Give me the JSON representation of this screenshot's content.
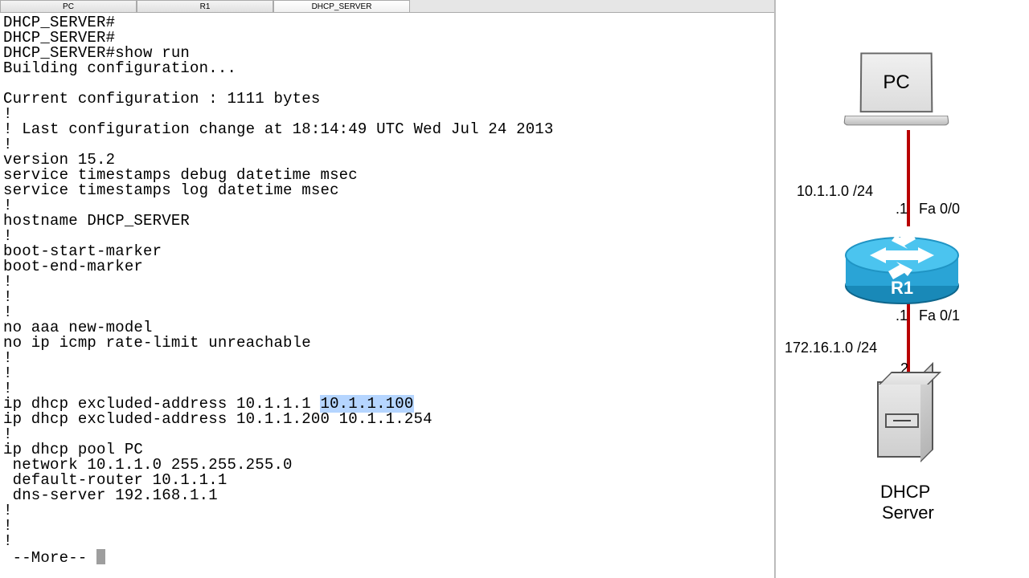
{
  "tabs": [
    {
      "label": "PC"
    },
    {
      "label": "R1"
    },
    {
      "label": "DHCP_SERVER"
    }
  ],
  "activeTab": 2,
  "terminal": {
    "lines": [
      "DHCP_SERVER#",
      "DHCP_SERVER#",
      "DHCP_SERVER#show run",
      "Building configuration...",
      "",
      "Current configuration : 1111 bytes",
      "!",
      "! Last configuration change at 18:14:49 UTC Wed Jul 24 2013",
      "!",
      "version 15.2",
      "service timestamps debug datetime msec",
      "service timestamps log datetime msec",
      "!",
      "hostname DHCP_SERVER",
      "!",
      "boot-start-marker",
      "boot-end-marker",
      "!",
      "!",
      "!",
      "no aaa new-model",
      "no ip icmp rate-limit unreachable",
      "!",
      "!",
      "!"
    ],
    "excl1_a": "ip dhcp excluded-address 10.1.1.1 ",
    "excl1_b": "10.1.1.100",
    "excl2": "ip dhcp excluded-address 10.1.1.200 10.1.1.254",
    "tail": [
      "!",
      "ip dhcp pool PC",
      " network 10.1.1.0 255.255.255.0",
      " default-router 10.1.1.1",
      " dns-server 192.168.1.1",
      "!",
      "!",
      "!"
    ],
    "more": " --More-- "
  },
  "diagram": {
    "pc_label": "PC",
    "net1": "10.1.1.0 /24",
    "if_r1_up_ip": ".1",
    "if_r1_up_name": "Fa 0/0",
    "r1_label": "R1",
    "if_r1_dn_ip": ".1",
    "if_r1_dn_name": "Fa 0/1",
    "net2": "172.16.1.0 /24",
    "server_ip": ".2",
    "server_label1": "DHCP",
    "server_label2": "Server"
  }
}
